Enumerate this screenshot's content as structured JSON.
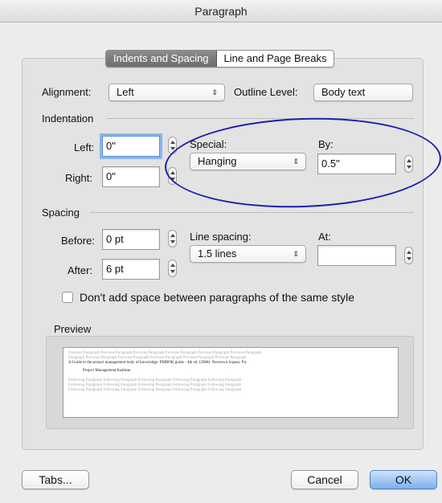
{
  "window": {
    "title": "Paragraph"
  },
  "tabs": [
    {
      "label": "Indents and Spacing"
    },
    {
      "label": "Line and Page Breaks"
    }
  ],
  "alignment": {
    "label": "Alignment:",
    "value": "Left"
  },
  "outline_level": {
    "label": "Outline Level:",
    "value": "Body text"
  },
  "indentation": {
    "heading": "Indentation",
    "left_label": "Left:",
    "left_value": "0\"",
    "right_label": "Right:",
    "right_value": "0\"",
    "special_label": "Special:",
    "special_value": "Hanging",
    "by_label": "By:",
    "by_value": "0.5\""
  },
  "spacing": {
    "heading": "Spacing",
    "before_label": "Before:",
    "before_value": "0 pt",
    "after_label": "After:",
    "after_value": "6 pt",
    "line_spacing_label": "Line spacing:",
    "line_spacing_value": "1.5 lines",
    "at_label": "At:",
    "at_value": ""
  },
  "dont_add_space": {
    "label": "Don't add space between paragraphs of the same style",
    "checked": false
  },
  "preview": {
    "heading": "Preview",
    "previous_1": "Previous Paragraph Previous Paragraph Previous Paragraph Previous Paragraph Previous Paragraph Previous Paragraph",
    "previous_2": "Paragraph Previous Paragraph Previous Paragraph Previous Paragraph Previous Paragraph Previous Paragraph",
    "current_1": "A Guide to the project management body of knowledge: PMBOK guide - 4th ed. (2008). Newtown Square, Pa:",
    "current_2": "Project Management Institute.",
    "following_1": "Following Paragraph Following Paragraph Following Paragraph Following Paragraph Following Paragraph",
    "following_2": "Following Paragraph Following Paragraph Following Paragraph Following Paragraph Following Paragraph",
    "following_3": "Following Paragraph Following Paragraph Following Paragraph Following Paragraph Following Paragraph"
  },
  "buttons": {
    "tabs": "Tabs...",
    "cancel": "Cancel",
    "ok": "OK"
  },
  "colors": {
    "highlight_ellipse": "#1d1fb0",
    "default_button": "#7cb0ee",
    "focus_ring": "#8bb5ec"
  },
  "icons": {
    "popup_arrows": "up-down-chevron-icon",
    "stepper": "stepper-icon"
  }
}
